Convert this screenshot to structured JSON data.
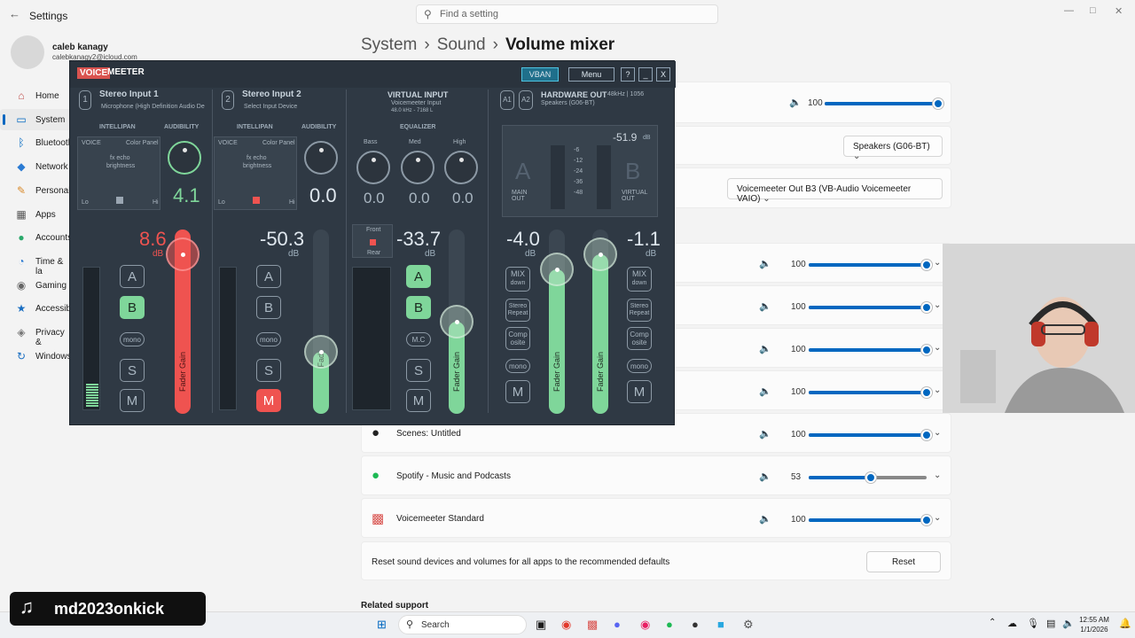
{
  "window": {
    "title": "Settings",
    "search_placeholder": "Find a setting"
  },
  "user": {
    "name": "caleb kanagy",
    "email": "calebkanagy2@icloud.com"
  },
  "nav": [
    {
      "label": "Home",
      "icon": "home-icon"
    },
    {
      "label": "System",
      "icon": "system-icon",
      "selected": true
    },
    {
      "label": "Bluetooth",
      "icon": "bluetooth-icon"
    },
    {
      "label": "Network",
      "icon": "network-icon"
    },
    {
      "label": "Personali",
      "icon": "brush-icon"
    },
    {
      "label": "Apps",
      "icon": "apps-icon"
    },
    {
      "label": "Accounts",
      "icon": "accounts-icon"
    },
    {
      "label": "Time & la",
      "icon": "globe-icon"
    },
    {
      "label": "Gaming",
      "icon": "gaming-icon"
    },
    {
      "label": "Accessibi",
      "icon": "accessibility-icon"
    },
    {
      "label": "Privacy &",
      "icon": "shield-icon"
    },
    {
      "label": "Windows",
      "icon": "update-icon"
    }
  ],
  "breadcrumb": {
    "a": "System",
    "b": "Sound",
    "c": "Volume mixer"
  },
  "system": {
    "master_volume": "100",
    "master_fraction": 1.0,
    "output_device": "Speakers (G06-BT)",
    "input_device": "Voicemeeter Out B3 (VB-Audio Voicemeeter VAIO)"
  },
  "apps": [
    {
      "name": "",
      "volume": "100",
      "fraction": 1.0
    },
    {
      "name": "",
      "volume": "100",
      "fraction": 1.0
    },
    {
      "name": "",
      "volume": "100",
      "fraction": 1.0
    },
    {
      "name": "",
      "volume": "100",
      "fraction": 1.0
    },
    {
      "name": "OBS 32.0.4 - Profile: Untitled - Scenes: Untitled",
      "volume": "100",
      "fraction": 1.0
    },
    {
      "name": "Spotify - Music and Podcasts",
      "volume": "53",
      "fraction": 0.53
    },
    {
      "name": "Voicemeeter Standard",
      "volume": "100",
      "fraction": 1.0
    }
  ],
  "reset": {
    "text": "Reset sound devices and volumes for all apps to the recommended defaults",
    "button": "Reset"
  },
  "related": "Related support",
  "voicemeeter": {
    "logo_a": "VOICE",
    "logo_b": "MEETER",
    "vban": "VBAN",
    "menu": "Menu",
    "help": "?",
    "min": "_",
    "close": "X",
    "strip1": {
      "num": "1",
      "title": "Stereo Input 1",
      "device": "Microphone (High Definition Audio De",
      "audibility": "4.1",
      "gain": "8.6",
      "db": "dB",
      "fader_fraction": 0.95
    },
    "strip2": {
      "num": "2",
      "title": "Stereo Input 2",
      "device": "Select Input Device",
      "audibility": "0.0",
      "gain": "-50.3",
      "db": "dB",
      "fader_fraction": 0.3
    },
    "virtual": {
      "title": "VIRTUAL INPUT",
      "device": "Voicemeeter Input",
      "rate": "48.0 kHz - 7168 L",
      "eq_label": "EQUALIZER",
      "bass": "0.0",
      "med": "0.0",
      "high": "0.0",
      "bass_l": "Bass",
      "med_l": "Med",
      "high_l": "High",
      "db": "dB",
      "gain": "-33.7",
      "fader_fraction": 0.5
    },
    "hw": {
      "a1": "A1",
      "a2": "A2",
      "title": "HARDWARE OUT",
      "rate": "48kHz | 1056",
      "device": "Speakers (G06-BT)",
      "peak": "-51.9",
      "db": "dB",
      "main_a": "A",
      "main_out": "MAIN OUT",
      "virt_b": "B",
      "virt_out": "VIRTUAL OUT",
      "scale": [
        "-6",
        "-12",
        "-24",
        "-36",
        "-48"
      ],
      "gain_a": "-4.0",
      "gain_b": "-1.1",
      "fader_a_fraction": 0.85,
      "fader_b_fraction": 0.95
    },
    "labels": {
      "intellipan": "INTELLIPAN",
      "audibility": "AUDIBILITY",
      "voice": "VOICE",
      "color_panel": "Color Panel",
      "fx_echo": "fx echo",
      "brightness": "brightness",
      "lo": "Lo",
      "hi": "Hi",
      "fader_gain": "Fader Gain",
      "fader_short": "Fadi",
      "mono": "mono",
      "mc": "M.C",
      "s": "S",
      "m": "M",
      "a": "A",
      "b": "B",
      "mix": "MIX",
      "down": "down",
      "stereo": "Stereo",
      "repeat": "Repeat",
      "comp": "Comp",
      "osite": "osite",
      "front": "Front",
      "rear": "Rear"
    }
  },
  "taskbar": {
    "search": "Search",
    "time": "12:55 AM",
    "date": "1/1/2026"
  },
  "overlay": {
    "username": "md2023onkick"
  },
  "colors": {
    "accent": "#0067c0",
    "vm_green": "#7fd69a",
    "vm_red": "#ef5350"
  }
}
